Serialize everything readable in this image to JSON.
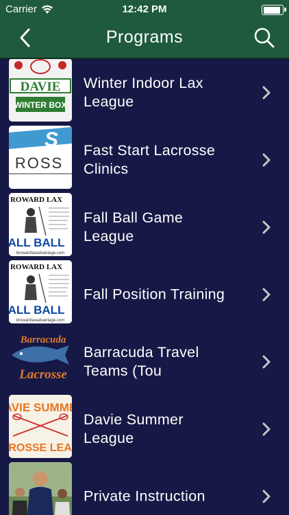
{
  "status_bar": {
    "carrier": "Carrier",
    "time": "12:42 PM",
    "battery_level": 0.95
  },
  "nav": {
    "title": "Programs",
    "back_icon": "chevron-left-icon",
    "search_icon": "search-icon"
  },
  "colors": {
    "nav_bg": "#1f5a3d",
    "list_bg": "#161845",
    "chevron": "#c8c8c8"
  },
  "programs": [
    {
      "label_line1": "Winter Indoor Lax",
      "label_line2": "League",
      "thumb": {
        "line1": "DAVIE",
        "line2": "WINTER BOX"
      }
    },
    {
      "label_line1": "Fast Start Lacrosse",
      "label_line2": "Clinics",
      "thumb": {
        "line1": "S",
        "line2": "ROSS"
      }
    },
    {
      "label_line1": "Fall Ball Game",
      "label_line2": "League",
      "thumb": {
        "line1": "ROWARD LAX",
        "line2": "ALL BALL",
        "line3": "browardlaxadvantage.com"
      }
    },
    {
      "label_line1": "Fall Position Training",
      "label_line2": "",
      "thumb": {
        "line1": "ROWARD LAX",
        "line2": "ALL BALL",
        "line3": "browardlaxadvantage.com"
      }
    },
    {
      "label_line1": "Barracuda Travel",
      "label_line2": "Teams (Tou",
      "thumb": {
        "line1": "Barracuda",
        "line2": "Lacrosse"
      }
    },
    {
      "label_line1": "Davie Summer",
      "label_line2": "League",
      "thumb": {
        "line1": "AVIE SUMME",
        "line2": "CROSSE LEAG"
      }
    },
    {
      "label_line1": "Private Instruction",
      "label_line2": "",
      "thumb": {
        "line1": "",
        "line2": ""
      }
    }
  ]
}
